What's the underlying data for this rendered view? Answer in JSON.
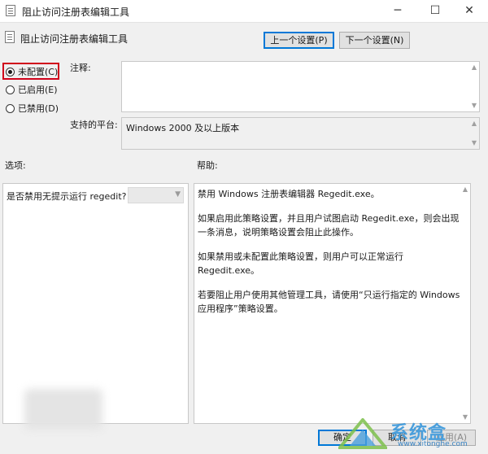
{
  "window": {
    "title": "阻止访问注册表编辑工具",
    "minimize_glyph": "─",
    "maximize_glyph": "☐",
    "close_glyph": "✕"
  },
  "header": {
    "title": "阻止访问注册表编辑工具",
    "prev_button": "上一个设置(P)",
    "next_button": "下一个设置(N)"
  },
  "state": {
    "options": [
      {
        "label": "未配置(C)",
        "checked": true
      },
      {
        "label": "已启用(E)",
        "checked": false
      },
      {
        "label": "已禁用(D)",
        "checked": false
      }
    ]
  },
  "comment": {
    "label": "注释:",
    "value": ""
  },
  "platform": {
    "label": "支持的平台:",
    "value": "Windows 2000 及以上版本"
  },
  "options_panel": {
    "label": "选项:",
    "setting_label": "是否禁用无提示运行 regedit?",
    "dropdown_value": ""
  },
  "help_panel": {
    "label": "帮助:",
    "paragraphs": [
      "禁用 Windows 注册表编辑器 Regedit.exe。",
      "如果启用此策略设置，并且用户试图启动 Regedit.exe，则会出现一条消息，说明策略设置会阻止此操作。",
      "如果禁用或未配置此策略设置，则用户可以正常运行 Regedit.exe。",
      "若要阻止用户使用其他管理工具，请使用“只运行指定的 Windows 应用程序”策略设置。"
    ]
  },
  "footer": {
    "ok_button": "确定",
    "cancel_button": "取消",
    "apply_button": "应用(A)"
  },
  "watermark": {
    "brand": "系统盒",
    "url": "www.xitonghe.com"
  },
  "icons": [
    "policy-setting-icon",
    "radio-icon",
    "scroll-arrow-icon",
    "chevron-down-icon"
  ]
}
